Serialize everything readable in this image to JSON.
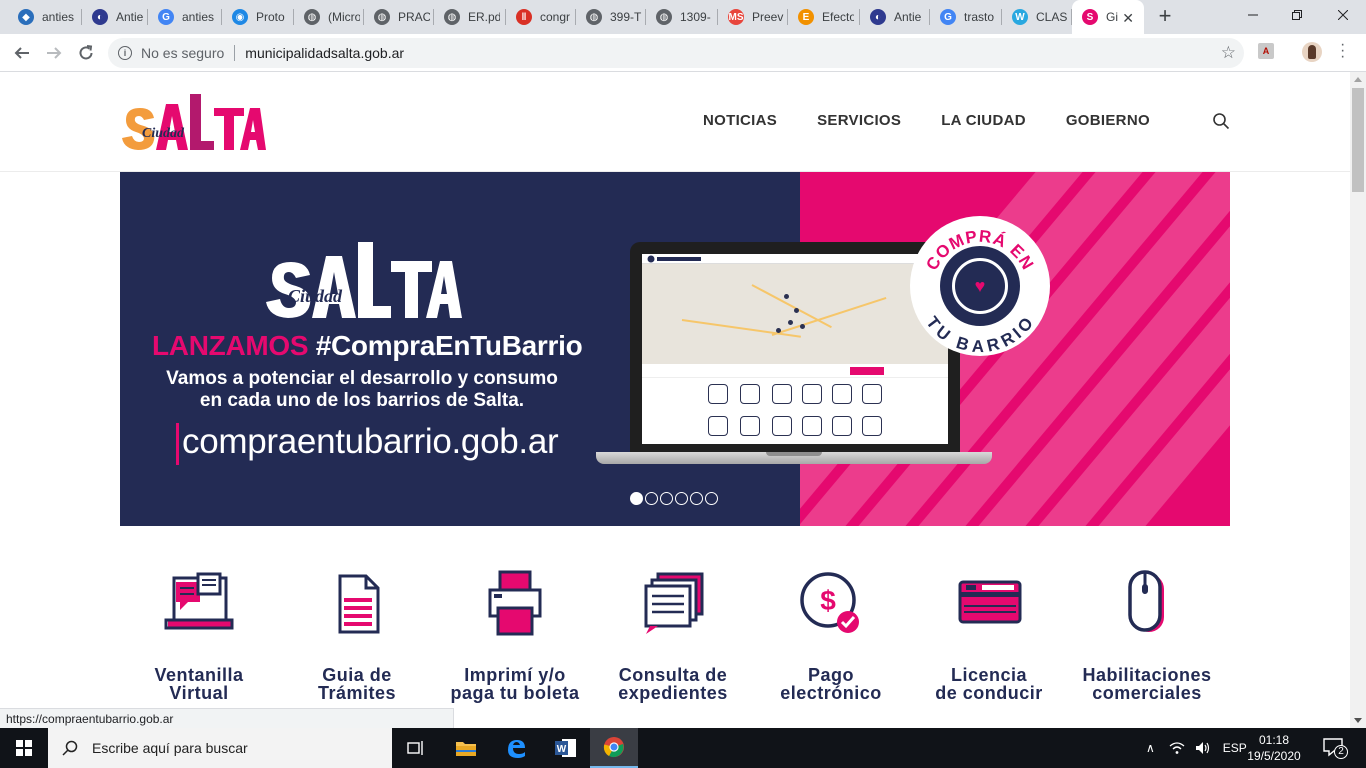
{
  "browser": {
    "tabs": [
      {
        "title": "anties",
        "icon": "graduation-cap-icon",
        "color": "#2a6ebb"
      },
      {
        "title": "Antie",
        "icon": "circle-logo-icon",
        "color": "#2f3a8f"
      },
      {
        "title": "anties",
        "icon": "google-icon",
        "color": "#4285f4"
      },
      {
        "title": "Proto",
        "icon": "blue-circle-icon",
        "color": "#1e88e5"
      },
      {
        "title": "(Micro",
        "icon": "globe-icon",
        "color": "#5f6368"
      },
      {
        "title": "PRAC",
        "icon": "globe-icon",
        "color": "#5f6368"
      },
      {
        "title": "ER.pd",
        "icon": "globe-icon",
        "color": "#5f6368"
      },
      {
        "title": "congr",
        "icon": "red-bars-icon",
        "color": "#d93025"
      },
      {
        "title": "399-T",
        "icon": "globe-icon",
        "color": "#5f6368"
      },
      {
        "title": "1309-",
        "icon": "globe-icon",
        "color": "#5f6368"
      },
      {
        "title": "Preev",
        "icon": "ms-icon",
        "color": "#e8453c"
      },
      {
        "title": "Efecto",
        "icon": "e-icon",
        "color": "#f29100"
      },
      {
        "title": "Antie",
        "icon": "circle-logo-icon",
        "color": "#2f3a8f"
      },
      {
        "title": "trasto",
        "icon": "google-icon",
        "color": "#4285f4"
      },
      {
        "title": "CLAS",
        "icon": "w-icon",
        "color": "#29a8e0"
      },
      {
        "title": "Gi",
        "icon": "salta-icon",
        "color": "#e5096f",
        "active": true
      }
    ],
    "new_tab_label": "+",
    "security_text": "No es seguro",
    "url": "municipalidadsalta.gob.ar",
    "status_url": "https://compraentubarrio.gob.ar"
  },
  "site": {
    "logo_text_small": "Ciudad",
    "logo_text_big": "SALTA",
    "nav": [
      "NOTICIAS",
      "SERVICIOS",
      "LA CIUDAD",
      "GOBIERNO"
    ],
    "colors": {
      "navy": "#232b54",
      "pink": "#e5096f",
      "orange": "#f39c3d"
    }
  },
  "hero": {
    "logo_small": "Ciudad",
    "logo_big": "SALTA",
    "headline_pink": "LANZAMOS",
    "headline_white": "#CompraEnTuBarrio",
    "subline_1": "Vamos a potenciar el desarrollo y consumo",
    "subline_2": "en cada uno de los barrios de Salta.",
    "website": "compraentubarrio.gob.ar",
    "badge_top": "COMPRÁ EN",
    "badge_bottom": "TU BARRIO",
    "slide_total": 6,
    "slide_active": 1
  },
  "quick_links": [
    {
      "line1": "Ventanilla",
      "line2": "Virtual",
      "icon": "laptop-chat-icon"
    },
    {
      "line1": "Guia de",
      "line2": "Trámites",
      "icon": "document-icon"
    },
    {
      "line1": "Imprimí y/o",
      "line2": "paga tu boleta",
      "icon": "printer-icon"
    },
    {
      "line1": "Consulta de",
      "line2": "expedientes",
      "icon": "stacked-documents-icon"
    },
    {
      "line1": "Pago",
      "line2": "electrónico",
      "icon": "dollar-check-icon"
    },
    {
      "line1": "Licencia",
      "line2": "de conducir",
      "icon": "license-card-icon"
    },
    {
      "line1": "Habilitaciones",
      "line2": "comerciales",
      "icon": "mouse-icon"
    }
  ],
  "taskbar": {
    "search_placeholder": "Escribe aquí para buscar",
    "language": "ESP",
    "time": "01:18",
    "date": "19/5/2020",
    "notification_count": "2"
  }
}
